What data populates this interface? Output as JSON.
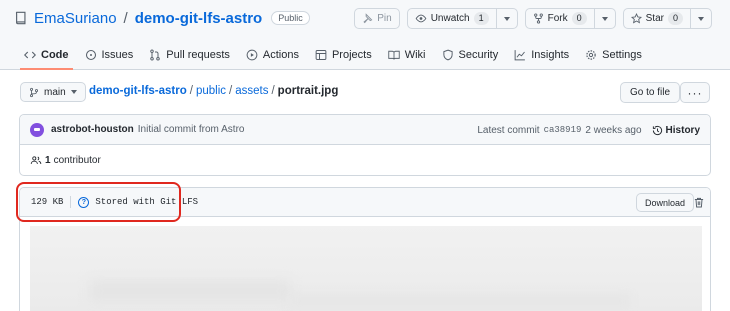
{
  "repo": {
    "owner": "EmaSuriano",
    "separator": "/",
    "name": "demo-git-lfs-astro",
    "visibility": "Public"
  },
  "actions": {
    "pin": "Pin",
    "unwatch": "Unwatch",
    "unwatch_count": "1",
    "fork": "Fork",
    "fork_count": "0",
    "star": "Star",
    "star_count": "0"
  },
  "tabs": [
    {
      "label": "Code",
      "icon": "code-icon",
      "active": true
    },
    {
      "label": "Issues",
      "icon": "issue-icon"
    },
    {
      "label": "Pull requests",
      "icon": "pull-request-icon"
    },
    {
      "label": "Actions",
      "icon": "play-icon"
    },
    {
      "label": "Projects",
      "icon": "table-icon"
    },
    {
      "label": "Wiki",
      "icon": "book-icon"
    },
    {
      "label": "Security",
      "icon": "shield-icon"
    },
    {
      "label": "Insights",
      "icon": "graph-icon"
    },
    {
      "label": "Settings",
      "icon": "gear-icon"
    }
  ],
  "branch": {
    "name": "main"
  },
  "breadcrumb": {
    "repo": "demo-git-lfs-astro",
    "dir1": "public",
    "dir2": "assets",
    "file": "portrait.jpg",
    "sep": "/"
  },
  "go_to_file": "Go to file",
  "more": "···",
  "commit": {
    "author": "astrobot-houston",
    "message": "Initial commit from Astro",
    "latest_label": "Latest commit",
    "sha": "ca38919",
    "time": "2 weeks ago",
    "history": "History"
  },
  "contributors": {
    "count": "1",
    "label": "contributor"
  },
  "file": {
    "size": "129 KB",
    "lfs_label": "Stored with Git LFS",
    "download": "Download"
  },
  "colors": {
    "accent": "#0969da",
    "highlight": "#e0281f",
    "active_tab_underline": "#fd8c73"
  }
}
